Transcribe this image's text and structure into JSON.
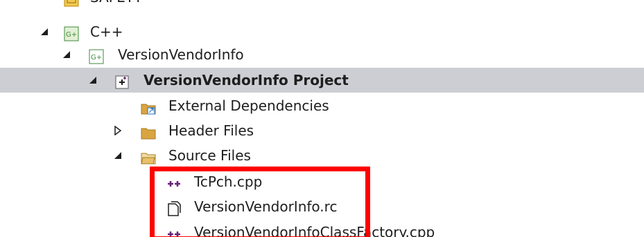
{
  "tree": {
    "items": [
      {
        "label": "SAFETY",
        "icon": "safety-project-icon",
        "state": "none",
        "selected": false
      },
      {
        "label": "C++",
        "icon": "cpp-folder-icon",
        "state": "expanded",
        "selected": false
      },
      {
        "label": "VersionVendorInfo",
        "icon": "cpp-project-icon",
        "state": "expanded",
        "selected": false
      },
      {
        "label": "VersionVendorInfo Project",
        "icon": "vc-project-icon",
        "state": "expanded",
        "selected": true
      },
      {
        "label": "External Dependencies",
        "icon": "external-dependencies-icon",
        "state": "none",
        "selected": false
      },
      {
        "label": "Header Files",
        "icon": "folder-icon",
        "state": "collapsed",
        "selected": false
      },
      {
        "label": "Source Files",
        "icon": "open-folder-icon",
        "state": "expanded",
        "selected": false
      },
      {
        "label": "TcPch.cpp",
        "icon": "cpp-file-icon",
        "state": "none",
        "selected": false
      },
      {
        "label": "VersionVendorInfo.rc",
        "icon": "resource-file-icon",
        "state": "none",
        "selected": false
      },
      {
        "label": "VersionVendorInfoClassFactory.cpp",
        "icon": "cpp-file-icon",
        "state": "none",
        "selected": false
      }
    ]
  },
  "annotation": {
    "color": "#ff0000"
  },
  "colors": {
    "selection_background": "#ccced3",
    "folder": "#d9a441",
    "cpp_icon": "#68217a",
    "project_green": "#3c8a3c"
  }
}
